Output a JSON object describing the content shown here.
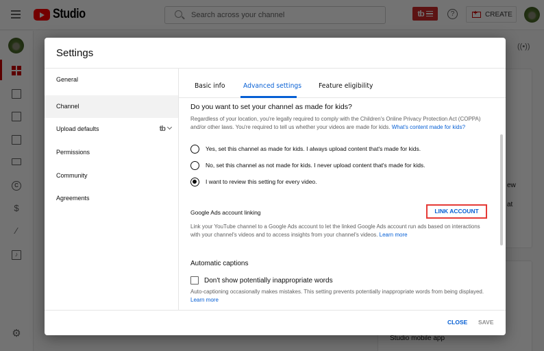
{
  "app": {
    "brand": "Studio",
    "search_placeholder": "Search across your channel",
    "tb_label": "tb",
    "help_label": "?",
    "create_label": "CREATE"
  },
  "leftnav": {
    "items": [
      {
        "name": "dashboard",
        "icon": "dashboard-icon",
        "active": true
      },
      {
        "name": "content",
        "icon": "video-library-icon"
      },
      {
        "name": "analytics",
        "icon": "analytics-icon"
      },
      {
        "name": "comments",
        "icon": "comments-icon"
      },
      {
        "name": "subtitles",
        "icon": "subtitles-icon"
      },
      {
        "name": "copyright",
        "icon": "copyright-icon",
        "glyph": "C"
      },
      {
        "name": "earn",
        "icon": "dollar-icon",
        "glyph": "$"
      },
      {
        "name": "customization",
        "icon": "magic-wand-icon",
        "glyph": "⁄"
      },
      {
        "name": "audio-library",
        "icon": "audio-library-icon",
        "glyph": "♪"
      }
    ],
    "settings_glyph": "⚙"
  },
  "background": {
    "live_glyph": "((•))",
    "peek_text_1": "ew",
    "peek_text_2": "at",
    "mobile_app": "Studio mobile app"
  },
  "dialog": {
    "title": "Settings",
    "side_items": [
      {
        "label": "General",
        "active": false
      },
      {
        "label": "Channel",
        "active": true
      },
      {
        "label": "Upload defaults",
        "active": false,
        "extra": "tb"
      },
      {
        "label": "Permissions",
        "active": false
      },
      {
        "label": "Community",
        "active": false
      },
      {
        "label": "Agreements",
        "active": false
      }
    ],
    "tabs": [
      {
        "label": "Basic info",
        "active": false
      },
      {
        "label": "Advanced settings",
        "active": true
      },
      {
        "label": "Feature eligibility",
        "active": false
      }
    ],
    "kids": {
      "title": "Do you want to set your channel as made for kids?",
      "desc": "Regardless of your location, you're legally required to comply with the Children's Online Privacy Protection Act (COPPA) and/or other laws. You're required to tell us whether your videos are made for kids.",
      "link": "What's content made for kids?",
      "options": [
        {
          "label": "Yes, set this channel as made for kids. I always upload content that's made for kids.",
          "checked": false
        },
        {
          "label": "No, set this channel as not made for kids. I never upload content that's made for kids.",
          "checked": false
        },
        {
          "label": "I want to review this setting for every video.",
          "checked": true
        }
      ]
    },
    "ads": {
      "label": "Google Ads account linking",
      "button": "LINK ACCOUNT",
      "desc": "Link your YouTube channel to a Google Ads account to let the linked Google Ads account run ads based on interactions with your channel's videos and to access insights from your channel's videos.",
      "link": "Learn more"
    },
    "captions": {
      "title": "Automatic captions",
      "checkbox_label": "Don't show potentially inappropriate words",
      "checked": false,
      "desc": "Auto-captioning occasionally makes mistakes. This setting prevents potentially inappropriate words from being displayed.",
      "link": "Learn more"
    },
    "footer": {
      "close": "CLOSE",
      "save": "SAVE"
    }
  },
  "colors": {
    "accent_blue": "#065fd4",
    "brand_red": "#ff0000",
    "highlight_red": "#e53935"
  }
}
